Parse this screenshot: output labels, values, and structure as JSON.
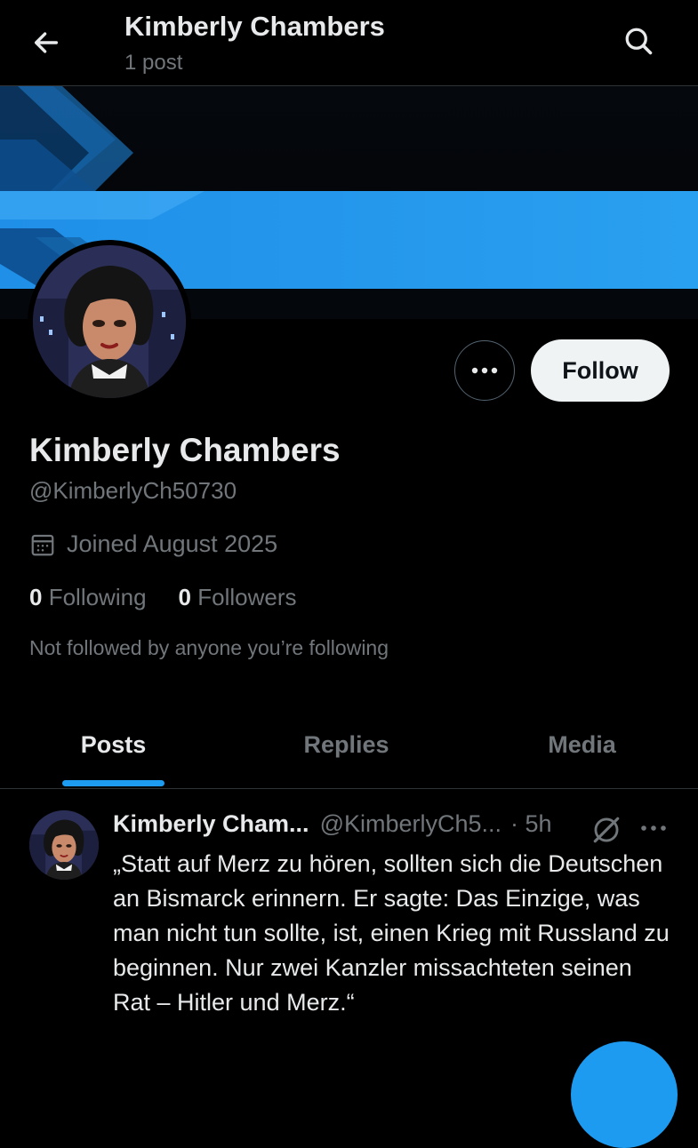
{
  "header": {
    "title": "Kimberly Chambers",
    "subtitle": "1 post"
  },
  "profile": {
    "follow_label": "Follow",
    "name": "Kimberly Chambers",
    "handle": "@KimberlyCh50730",
    "joined": "Joined August 2025",
    "following_count": "0",
    "following_label": "Following",
    "followers_count": "0",
    "followers_label": "Followers",
    "not_followed_text": "Not followed by anyone you’re following"
  },
  "tabs": [
    {
      "label": "Posts",
      "active": true
    },
    {
      "label": "Replies",
      "active": false
    },
    {
      "label": "Media",
      "active": false
    }
  ],
  "post": {
    "author_name": "Kimberly Cham...",
    "author_handle": "@KimberlyCh5...",
    "time": "· 5h",
    "text": "„Statt auf Merz zu hören, sollten sich die Deutschen an Bismarck erinnern. Er sagte: Das Einzige, was man nicht tun sollte, ist, einen Krieg mit Russland zu beginnen. Nur zwei Kanzler missachteten seinen Rat – Hitler und Merz.“"
  },
  "icons": {
    "back": "arrow-left-icon",
    "search": "search-icon",
    "more": "more-horizontal-icon",
    "calendar": "calendar-icon",
    "grok": "grok-icon"
  },
  "colors": {
    "background": "#000000",
    "primary_text": "#e7e9ea",
    "secondary_text": "#71767b",
    "accent": "#1d9bf0",
    "divider": "#2f3336",
    "follow_button_bg": "#eff3f4"
  }
}
